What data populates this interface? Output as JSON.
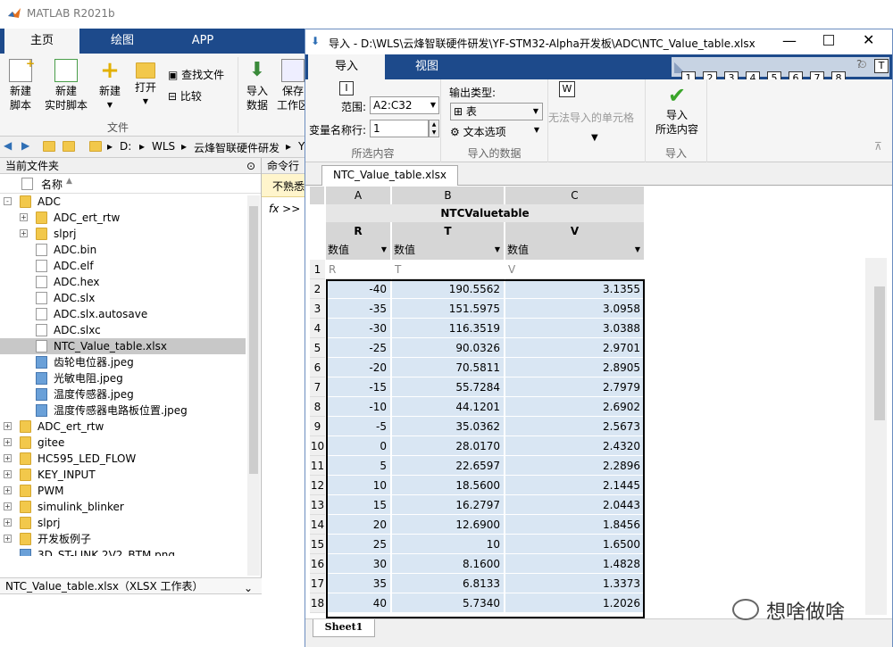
{
  "app": {
    "title": "MATLAB R2021b"
  },
  "ribbon": {
    "tabs": [
      "主页",
      "绘图",
      "APP"
    ],
    "buttons": {
      "new_script": "新建\n脚本",
      "new_live_script": "新建\n实时脚本",
      "new": "新建",
      "open": "打开",
      "find_files": "查找文件",
      "compare": "比较",
      "import_data": "导入\n数据",
      "save_work": "保存\n工作区"
    },
    "group_file": "文件"
  },
  "address": {
    "parts": [
      "D:",
      "WLS",
      "云烽智联硬件研发",
      "Y"
    ]
  },
  "current_folder": {
    "title": "当前文件夹",
    "name_header": "名称",
    "items": [
      {
        "name": "ADC",
        "type": "folder",
        "indent": 0,
        "exp": "-"
      },
      {
        "name": "ADC_ert_rtw",
        "type": "folder",
        "indent": 1,
        "exp": "+"
      },
      {
        "name": "slprj",
        "type": "folder",
        "indent": 1,
        "exp": "+"
      },
      {
        "name": "ADC.bin",
        "type": "doc",
        "indent": 1
      },
      {
        "name": "ADC.elf",
        "type": "doc",
        "indent": 1
      },
      {
        "name": "ADC.hex",
        "type": "doc",
        "indent": 1
      },
      {
        "name": "ADC.slx",
        "type": "doc",
        "indent": 1
      },
      {
        "name": "ADC.slx.autosave",
        "type": "doc",
        "indent": 1
      },
      {
        "name": "ADC.slxc",
        "type": "doc",
        "indent": 1
      },
      {
        "name": "NTC_Value_table.xlsx",
        "type": "doc",
        "indent": 1,
        "selected": true
      },
      {
        "name": "齿轮电位器.jpeg",
        "type": "img",
        "indent": 1
      },
      {
        "name": "光敏电阻.jpeg",
        "type": "img",
        "indent": 1
      },
      {
        "name": "温度传感器.jpeg",
        "type": "img",
        "indent": 1
      },
      {
        "name": "温度传感器电路板位置.jpeg",
        "type": "img",
        "indent": 1
      },
      {
        "name": "ADC_ert_rtw",
        "type": "folder",
        "indent": 0,
        "exp": "+"
      },
      {
        "name": "gitee",
        "type": "folder",
        "indent": 0,
        "exp": "+"
      },
      {
        "name": "HC595_LED_FLOW",
        "type": "folder",
        "indent": 0,
        "exp": "+"
      },
      {
        "name": "KEY_INPUT",
        "type": "folder",
        "indent": 0,
        "exp": "+"
      },
      {
        "name": "PWM",
        "type": "folder",
        "indent": 0,
        "exp": "+"
      },
      {
        "name": "simulink_blinker",
        "type": "folder",
        "indent": 0,
        "exp": "+"
      },
      {
        "name": "slprj",
        "type": "folder",
        "indent": 0,
        "exp": "+"
      },
      {
        "name": "开发板例子",
        "type": "folder",
        "indent": 0,
        "exp": "+"
      },
      {
        "name": "3D_ST-LINK 2V2_BTM.png",
        "type": "img",
        "indent": 0
      },
      {
        "name": "3D_ST-LINK 2V2_TOP",
        "type": "img",
        "indent": 0
      }
    ],
    "details": "NTC_Value_table.xlsx（XLSX 工作表）"
  },
  "command": {
    "title": "命令行",
    "warning": "不熟悉",
    "prompt": "fx >>"
  },
  "dialog": {
    "title": "导入 - D:\\WLS\\云烽智联硬件研发\\YF-STM32-Alpha开发板\\ADC\\NTC_Value_table.xlsx",
    "tabs": [
      "导入",
      "视图"
    ],
    "range_label": "范围:",
    "range_value": "A2:C32",
    "varname_label": "变量名称行:",
    "varname_value": "1",
    "group_selection": "所选内容",
    "output_type_label": "输出类型:",
    "output_type_value": "表",
    "text_options": "文本选项",
    "group_imported": "导入的数据",
    "unimportable": "无法导入的单元格",
    "import_button": "导入\n所选内容",
    "group_import": "导入",
    "doc_tab": "NTC_Value_table.xlsx",
    "tooltip_I": "I",
    "tooltip_W": "W",
    "quick_nums": [
      "1",
      "2",
      "3",
      "4",
      "5",
      "6",
      "7",
      "8"
    ],
    "quick_T": "T",
    "sheet_tab": "Sheet1"
  },
  "grid": {
    "columns": [
      "A",
      "B",
      "C"
    ],
    "table_name": "NTCValuetable",
    "var_names": [
      "R",
      "T",
      "V"
    ],
    "var_types": [
      "数值",
      "数值",
      "数值"
    ],
    "header_row": [
      "R",
      "T",
      "V"
    ],
    "rows": [
      [
        "-40",
        "190.5562",
        "3.1355"
      ],
      [
        "-35",
        "151.5975",
        "3.0958"
      ],
      [
        "-30",
        "116.3519",
        "3.0388"
      ],
      [
        "-25",
        "90.0326",
        "2.9701"
      ],
      [
        "-20",
        "70.5811",
        "2.8905"
      ],
      [
        "-15",
        "55.7284",
        "2.7979"
      ],
      [
        "-10",
        "44.1201",
        "2.6902"
      ],
      [
        "-5",
        "35.0362",
        "2.5673"
      ],
      [
        "0",
        "28.0170",
        "2.4320"
      ],
      [
        "5",
        "22.6597",
        "2.2896"
      ],
      [
        "10",
        "18.5600",
        "2.1445"
      ],
      [
        "15",
        "16.2797",
        "2.0443"
      ],
      [
        "20",
        "12.6900",
        "1.8456"
      ],
      [
        "25",
        "10",
        "1.6500"
      ],
      [
        "30",
        "8.1600",
        "1.4828"
      ],
      [
        "35",
        "6.8133",
        "1.3373"
      ],
      [
        "40",
        "5.7340",
        "1.2026"
      ]
    ]
  },
  "watermark": "想啥做啥"
}
